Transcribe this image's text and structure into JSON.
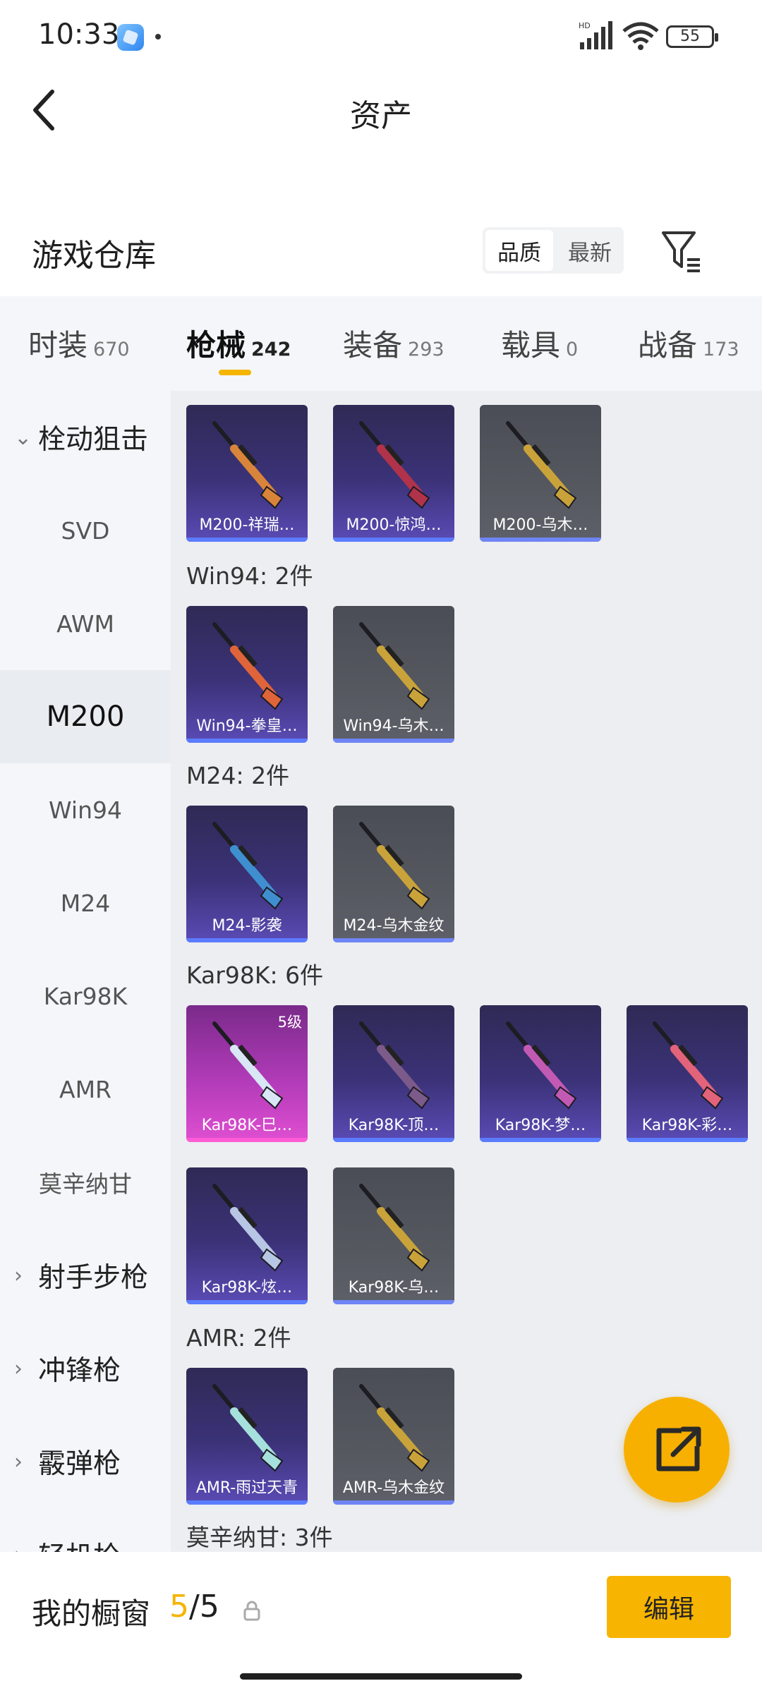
{
  "status": {
    "time": "10:33",
    "battery": "55",
    "network_label": "HD"
  },
  "header": {
    "title": "资产",
    "back_icon": "back-chevron-icon"
  },
  "warehouse": {
    "title": "游戏仓库",
    "sort_options": [
      "品质",
      "最新"
    ],
    "sort_selected": "品质",
    "filter_icon": "filter-icon"
  },
  "tabs": [
    {
      "label": "时装",
      "count": "670"
    },
    {
      "label": "枪械",
      "count": "242",
      "active": true
    },
    {
      "label": "装备",
      "count": "293"
    },
    {
      "label": "载具",
      "count": "0"
    },
    {
      "label": "战备",
      "count": "173"
    }
  ],
  "sidebar": [
    {
      "label": "栓动狙击",
      "group": true,
      "expanded": true
    },
    {
      "label": "SVD"
    },
    {
      "label": "AWM"
    },
    {
      "label": "M200",
      "active": true
    },
    {
      "label": "Win94"
    },
    {
      "label": "M24"
    },
    {
      "label": "Kar98K"
    },
    {
      "label": "AMR"
    },
    {
      "label": "莫辛纳甘"
    },
    {
      "label": "射手步枪",
      "group": true
    },
    {
      "label": "冲锋枪",
      "group": true
    },
    {
      "label": "霰弹枪",
      "group": true
    },
    {
      "label": "轻机枪",
      "group": true
    }
  ],
  "sections": [
    {
      "label": "",
      "items": [
        {
          "name": "M200-祥瑞…",
          "quality": "purple",
          "gun": "#d8843a"
        },
        {
          "name": "M200-惊鸿…",
          "quality": "purple",
          "gun": "#b0334b"
        },
        {
          "name": "M200-乌木…",
          "quality": "gray",
          "gun": "#c9a33a"
        }
      ]
    },
    {
      "label": "Win94: 2件",
      "items": [
        {
          "name": "Win94-拳皇…",
          "quality": "purple",
          "gun": "#e0643a"
        },
        {
          "name": "Win94-乌木…",
          "quality": "gray",
          "gun": "#c9a33a"
        }
      ]
    },
    {
      "label": "M24: 2件",
      "items": [
        {
          "name": "M24-影袭",
          "quality": "purple",
          "gun": "#3f8fd0"
        },
        {
          "name": "M24-乌木金纹",
          "quality": "gray",
          "gun": "#c9a33a"
        }
      ]
    },
    {
      "label": "Kar98K: 6件",
      "items": [
        {
          "name": "Kar98K-巳…",
          "quality": "pink",
          "gun": "#d9e6f5",
          "level": "5级"
        },
        {
          "name": "Kar98K-顶…",
          "quality": "purple",
          "gun": "#7c5a8a"
        },
        {
          "name": "Kar98K-梦…",
          "quality": "purple",
          "gun": "#c25ab4"
        },
        {
          "name": "Kar98K-彩…",
          "quality": "purple",
          "gun": "#e2637a"
        },
        {
          "name": "Kar98K-炫…",
          "quality": "purple",
          "gun": "#b8c6e6"
        },
        {
          "name": "Kar98K-乌…",
          "quality": "gray",
          "gun": "#c9a33a"
        }
      ]
    },
    {
      "label": "AMR: 2件",
      "items": [
        {
          "name": "AMR-雨过天青",
          "quality": "purple",
          "gun": "#a6e0dc"
        },
        {
          "name": "AMR-乌木金纹",
          "quality": "gray",
          "gun": "#c9a33a"
        }
      ]
    },
    {
      "label": "莫辛纳甘: 3件",
      "items": []
    }
  ],
  "share_icon": "share-icon",
  "bottom": {
    "showcase_label": "我的橱窗",
    "showcase_current": "5",
    "showcase_total": "/5",
    "lock_icon": "lock-icon",
    "edit_label": "编辑"
  },
  "colors": {
    "accent": "#f5b400",
    "purple_card": "#3b3278",
    "gray_card": "#55585f",
    "pink_card": "#b13bb8"
  }
}
